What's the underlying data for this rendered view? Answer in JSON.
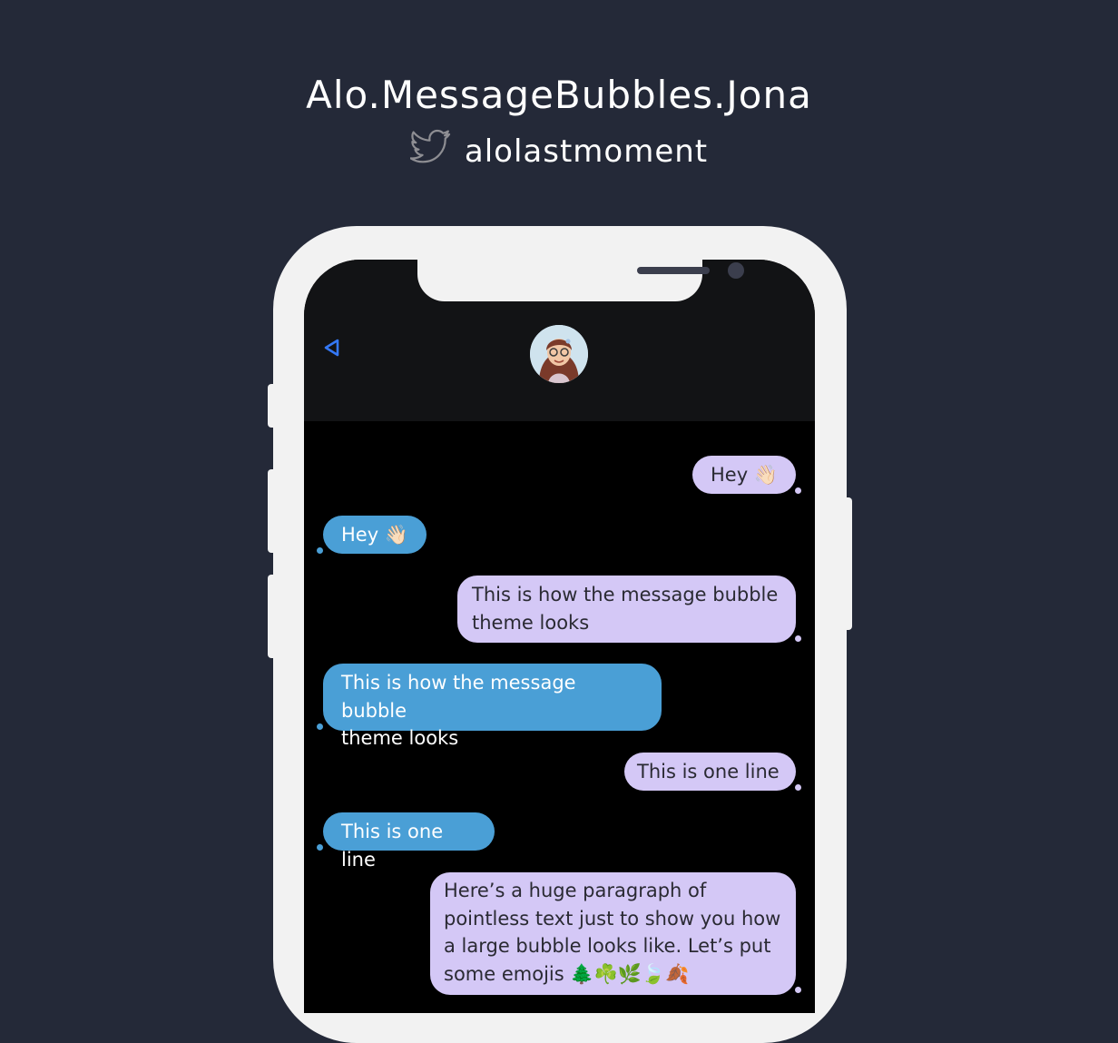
{
  "header": {
    "title": "Alo.MessageBubbles.Jona",
    "handle": "alolastmoment",
    "handle_icon": "twitter-bird-icon"
  },
  "chat": {
    "back_icon": "back-arrow-icon",
    "accent_color": "#3478f6",
    "outgoing_color": "#d4c8f6",
    "incoming_color": "#4a9fd6",
    "messages": [
      {
        "dir": "outgoing",
        "lines": [
          "Hey 👋🏻"
        ]
      },
      {
        "dir": "incoming",
        "lines": [
          "Hey 👋🏻"
        ]
      },
      {
        "dir": "outgoing",
        "lines": [
          "This is how the message bubble",
          "theme looks"
        ]
      },
      {
        "dir": "incoming",
        "lines": [
          "This is how the message bubble",
          "theme looks"
        ]
      },
      {
        "dir": "outgoing",
        "lines": [
          "This is one line"
        ]
      },
      {
        "dir": "incoming",
        "lines": [
          "This is one line"
        ]
      },
      {
        "dir": "outgoing",
        "lines": [
          "Here’s a huge paragraph of",
          "pointless text just to show you how",
          "a large bubble looks like. Let’s put",
          "some emojis 🌲☘️🌿🍃🍂"
        ]
      }
    ]
  }
}
